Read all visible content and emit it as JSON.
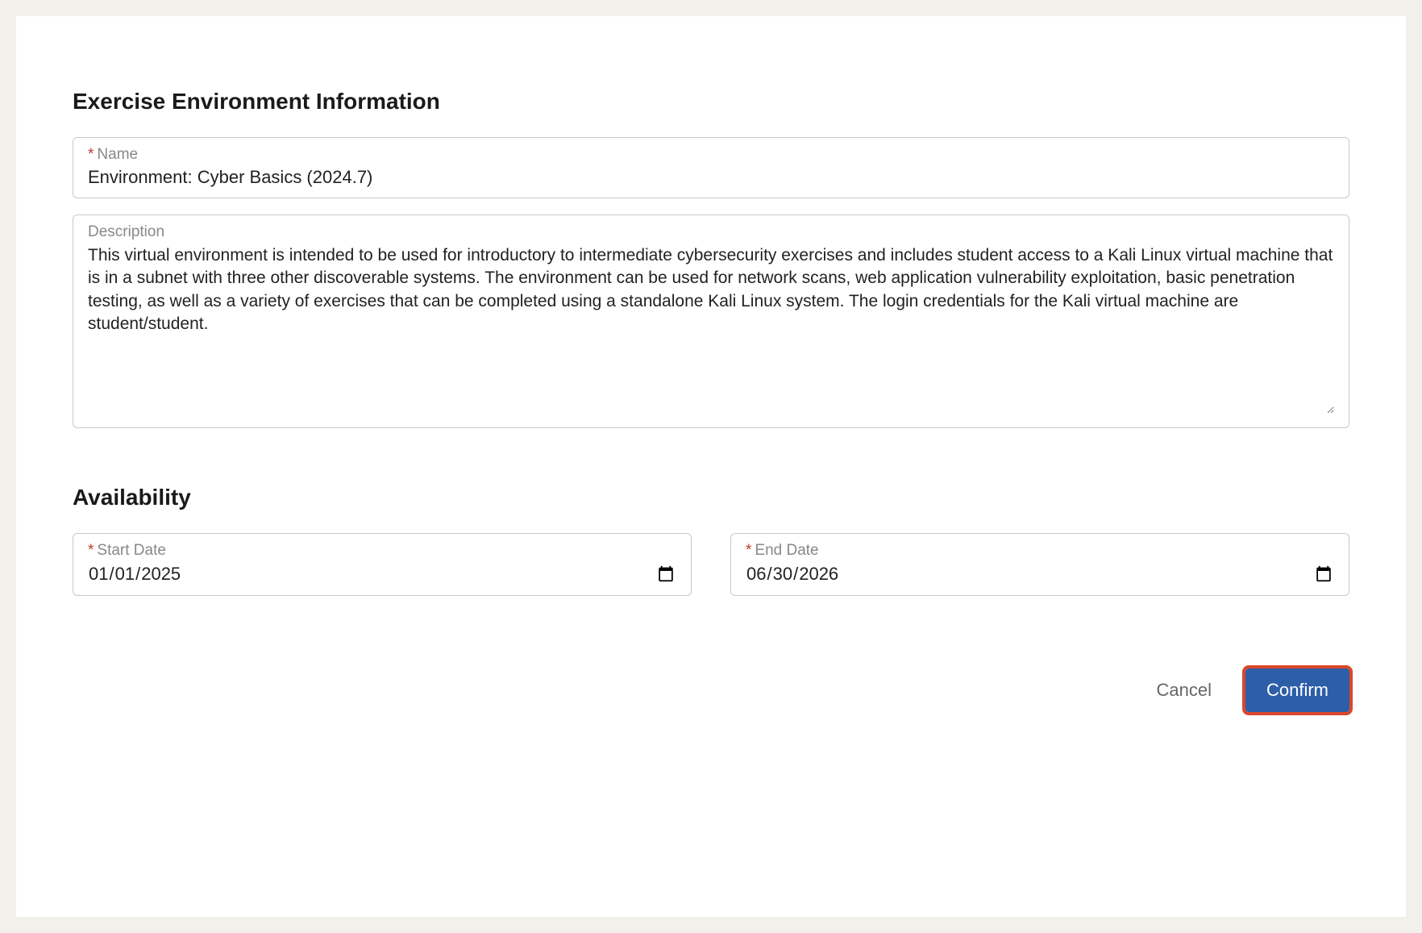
{
  "sections": {
    "environment": {
      "title": "Exercise Environment Information",
      "name": {
        "label": "Name",
        "required": true,
        "value": "Environment: Cyber Basics (2024.7)"
      },
      "description": {
        "label": "Description",
        "required": false,
        "value": "This virtual environment is intended to be used for introductory to intermediate cybersecurity exercises and includes student access to a Kali Linux virtual machine that is in a subnet with three other discoverable systems. The environment can be used for network scans, web application vulnerability exploitation, basic penetration testing, as well as a variety of exercises that can be completed using a standalone Kali Linux system. The login credentials for the Kali virtual machine are student/student."
      }
    },
    "availability": {
      "title": "Availability",
      "start_date": {
        "label": "Start Date",
        "required": true,
        "value": "2025-01-01",
        "display": "01/01/2025"
      },
      "end_date": {
        "label": "End Date",
        "required": true,
        "value": "2026-06-30",
        "display": "06/30/2026"
      }
    }
  },
  "buttons": {
    "cancel": "Cancel",
    "confirm": "Confirm"
  },
  "required_marker": "*"
}
